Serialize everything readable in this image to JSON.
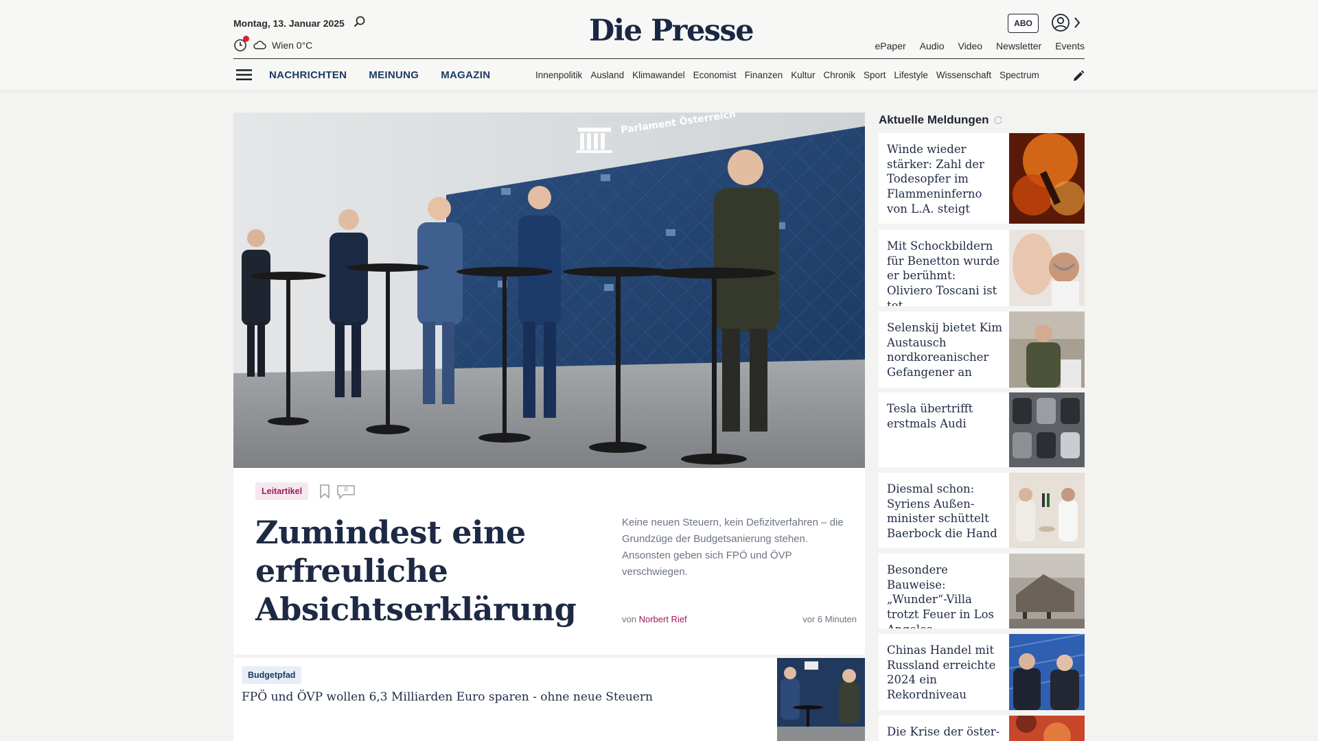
{
  "header": {
    "date": "Montag, 13. Januar 2025",
    "weather": "Wien 0°C",
    "logo": "Die Presse",
    "abo_label": "ABO",
    "top_links": [
      "ePaper",
      "Audio",
      "Video",
      "Newsletter",
      "Events"
    ],
    "main_nav": [
      "NACHRICHTEN",
      "MEINUNG",
      "MAGAZIN"
    ],
    "sub_nav": [
      "Innenpolitik",
      "Ausland",
      "Klimawandel",
      "Economist",
      "Finanzen",
      "Kultur",
      "Chronik",
      "Sport",
      "Lifestyle",
      "Wissenschaft",
      "Spectrum"
    ]
  },
  "hero": {
    "category": "Leitartikel",
    "comment_count": "0",
    "title": "Zumindest eine erfreuliche Absichtserklärung",
    "teaser": "Keine neuen Steuern, kein Defizitverfahren – die Grundzüge der Budgetsanierung stehen. Ansonsten geben sich FPÖ und ÖVP verschwiegen.",
    "author_prefix": "von",
    "author": "Norbert Rief",
    "time": "vor 6 Minuten",
    "image_text": "Parlament Österreich"
  },
  "secondary": {
    "category": "Budgetpfad",
    "title": "FPÖ und ÖVP wollen 6,3 Milliarden Euro sparen - ohne neue Steuern"
  },
  "sidebar": {
    "heading": "Aktuelle Meldungen",
    "items": [
      {
        "title": "Winde wieder stärker: Zahl der Todesopfer im Flammeninferno von L.A. steigt"
      },
      {
        "title": "Mit Schockbildern für Benetton wurde er berühmt: Oliviero Toscani ist tot"
      },
      {
        "title": "Selenskij bietet Kim Austausch nordkoreanischer Gefangener an"
      },
      {
        "title": "Tesla übertrifft erstmals Audi"
      },
      {
        "title": "Diesmal schon: Syriens Außen-minister schüttelt Baerbock die Hand"
      },
      {
        "title": "Besondere Bauweise: „Wunder“-Villa trotzt Feuer in Los Angeles"
      },
      {
        "title": "Chinas Handel mit Russland erreichte 2024 ein Rekordniveau"
      },
      {
        "title": "Die Krise der öster-"
      }
    ]
  },
  "colors": {
    "brand_navy": "#1a2744",
    "accent_magenta": "#9c1a5b",
    "nav_blue": "#1a3a66",
    "alert_red": "#e0202a"
  }
}
